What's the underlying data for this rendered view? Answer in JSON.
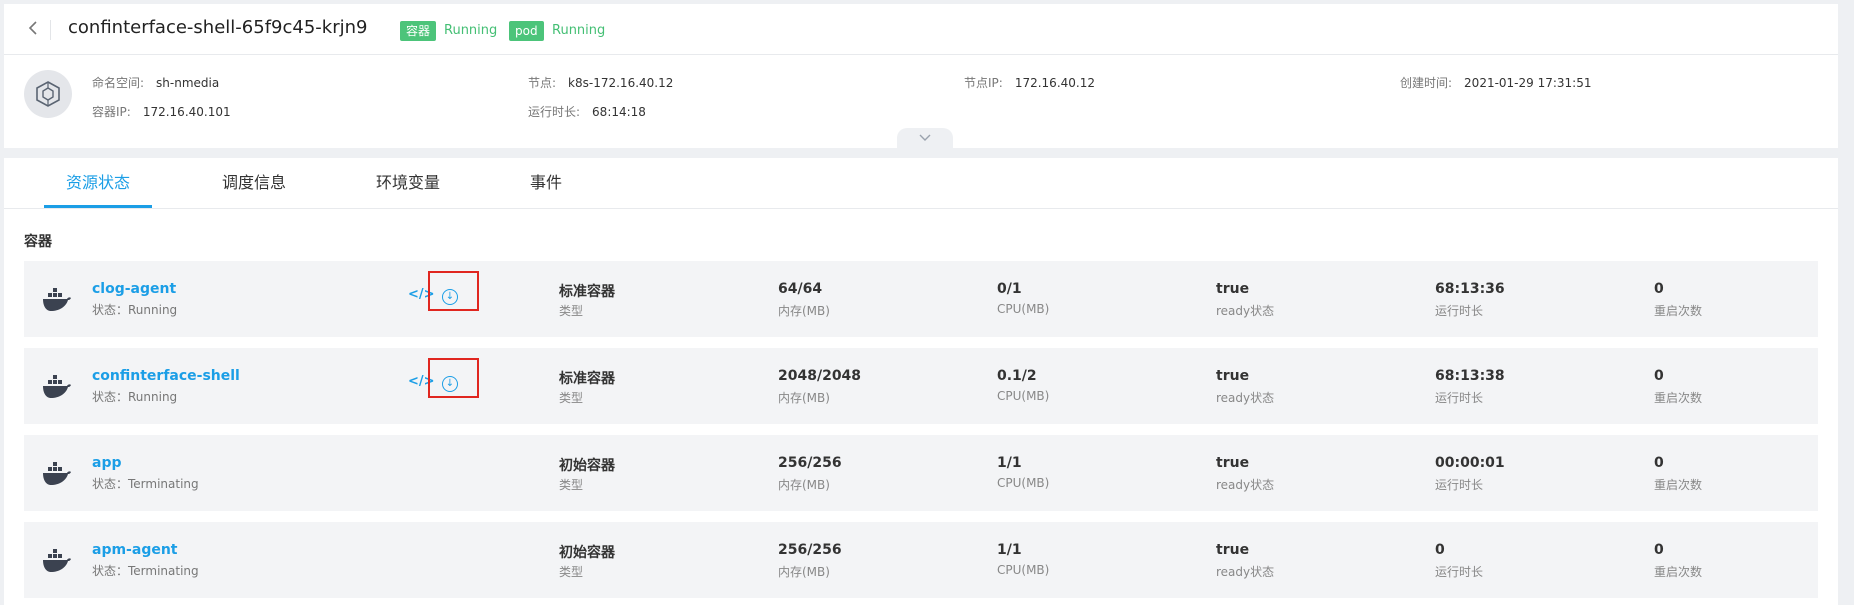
{
  "header": {
    "back_icon": "chevron-left-icon",
    "pod_name": "confinterface-shell-65f9c45-krjn9",
    "badges": [
      {
        "label": "容器",
        "status": "Running"
      },
      {
        "label": "pod",
        "status": "Running"
      }
    ],
    "accent_color": "#1b9ee6",
    "badge_color": "#4cc47a"
  },
  "info": {
    "icon": "container-cluster-icon",
    "namespace": {
      "key": "命名空间:",
      "value": "sh-nmedia"
    },
    "container_ip": {
      "key": "容器IP:",
      "value": "172.16.40.101"
    },
    "node": {
      "key": "节点:",
      "value": "k8s-172.16.40.12"
    },
    "uptime": {
      "key": "运行时长:",
      "value": "68:14:18"
    },
    "node_ip": {
      "key": "节点IP:",
      "value": "172.16.40.12"
    },
    "created": {
      "key": "创建时间:",
      "value": "2021-01-29 17:31:51"
    },
    "collapse_icon": "chevron-down-icon"
  },
  "tabs": [
    {
      "label": "资源状态",
      "active": true
    },
    {
      "label": "调度信息",
      "active": false
    },
    {
      "label": "环境变量",
      "active": false
    },
    {
      "label": "事件",
      "active": false
    }
  ],
  "section_title": "容器",
  "labels": {
    "type": "类型",
    "memory": "内存(MB)",
    "cpu": "CPU(MB)",
    "ready": "ready状态",
    "runtime": "运行时长",
    "restarts": "重启次数"
  },
  "containers": [
    {
      "name": "clog-agent",
      "status": "状态：Running",
      "type": "标准容器",
      "memory": "64/64",
      "cpu": "0/1",
      "ready": "true",
      "runtime": "68:13:36",
      "restarts": "0",
      "actions": true
    },
    {
      "name": "confinterface-shell",
      "status": "状态：Running",
      "type": "标准容器",
      "memory": "2048/2048",
      "cpu": "0.1/2",
      "ready": "true",
      "runtime": "68:13:38",
      "restarts": "0",
      "actions": true
    },
    {
      "name": "app",
      "status": "状态：Terminating",
      "type": "初始容器",
      "memory": "256/256",
      "cpu": "1/1",
      "ready": "true",
      "runtime": "00:00:01",
      "restarts": "0",
      "actions": false
    },
    {
      "name": "apm-agent",
      "status": "状态：Terminating",
      "type": "初始容器",
      "memory": "256/256",
      "cpu": "1/1",
      "ready": "true",
      "runtime": "0",
      "restarts": "0",
      "actions": false
    }
  ]
}
